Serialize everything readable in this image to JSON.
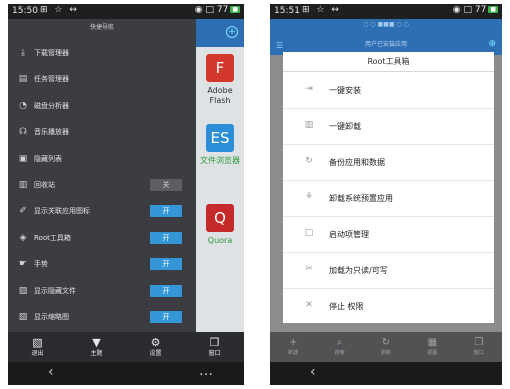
{
  "left_phone": {
    "status": {
      "time": "15:50",
      "icons": "⊞ ☆ ↔",
      "right": "◉ □ 77",
      "battery": "■"
    },
    "drawer_title": "快捷导航",
    "items": [
      {
        "icon": "⤓",
        "icon_name": "download-icon",
        "label": "下载管理器"
      },
      {
        "icon": "▤",
        "icon_name": "task-icon",
        "label": "任务管理器"
      },
      {
        "icon": "◔",
        "icon_name": "disk-icon",
        "label": "磁盘分析器"
      },
      {
        "icon": "☊",
        "icon_name": "headphones-icon",
        "label": "音乐播放器"
      },
      {
        "icon": "▣",
        "icon_name": "hidden-list-icon",
        "label": "隐藏列表"
      },
      {
        "icon": "▥",
        "icon_name": "trash-icon",
        "label": "回收站",
        "toggle": "关",
        "toggle_on": false
      },
      {
        "icon": "✐",
        "icon_name": "assoc-icon",
        "label": "显示关联应用图标",
        "toggle": "开",
        "toggle_on": true
      },
      {
        "icon": "◈",
        "icon_name": "root-tools-icon",
        "label": "Root工具箱",
        "toggle": "开",
        "toggle_on": true
      },
      {
        "icon": "☛",
        "icon_name": "gesture-icon",
        "label": "手势",
        "toggle": "开",
        "toggle_on": true
      },
      {
        "icon": "▧",
        "icon_name": "hidden-files-icon",
        "label": "显示隐藏文件",
        "toggle": "开",
        "toggle_on": true
      },
      {
        "icon": "▨",
        "icon_name": "thumbnail-icon",
        "label": "显示缩略图",
        "toggle": "开",
        "toggle_on": true
      }
    ],
    "bg_apps": [
      {
        "glyph": "F",
        "color": "#d4372c",
        "label": "Adobe Flash",
        "label_color": "#2b3036"
      },
      {
        "glyph": "ES",
        "color": "#2a8fd6",
        "label": "文件浏览器",
        "label_color": "#2e9a3a"
      },
      {
        "glyph": "Q",
        "color": "#c42a2a",
        "label": "Quora",
        "label_color": "#2e9a3a"
      }
    ],
    "tabs": [
      {
        "icon": "▧",
        "label": "退出"
      },
      {
        "icon": "▼",
        "label": "主题"
      },
      {
        "icon": "⚙",
        "label": "设置"
      },
      {
        "icon": "❐",
        "label": "窗口"
      }
    ],
    "nav": {
      "back": "‹",
      "more": "…"
    }
  },
  "right_phone": {
    "status": {
      "time": "15:51",
      "icons": "⊞ ☆ ↔",
      "right": "◉ □ 77",
      "battery": "■"
    },
    "header_dots": "○ ○ ■■■ ○ ○",
    "header_sub": "用户已安装应用",
    "dialog_title": "Root工具箱",
    "options": [
      {
        "icon": "⇥",
        "icon_name": "install-icon",
        "label": "一键安装"
      },
      {
        "icon": "▥",
        "icon_name": "uninstall-icon",
        "label": "一键卸载"
      },
      {
        "icon": "↻",
        "icon_name": "backup-icon",
        "label": "备份应用和数据"
      },
      {
        "icon": "⚘",
        "icon_name": "system-apps-icon",
        "label": "卸载系统预置应用"
      },
      {
        "icon": "□",
        "icon_name": "startup-icon",
        "label": "启动项管理"
      },
      {
        "icon": "✂",
        "icon_name": "mount-icon",
        "label": "加载为只读/可写"
      },
      {
        "icon": "✕",
        "icon_name": "stop-icon",
        "label": "停止 权限"
      }
    ],
    "tabs": [
      {
        "icon": "+",
        "label": "新建"
      },
      {
        "icon": "⌕",
        "label": "搜索"
      },
      {
        "icon": "↻",
        "label": "刷新"
      },
      {
        "icon": "▦",
        "label": "视图"
      },
      {
        "icon": "❐",
        "label": "窗口"
      }
    ],
    "nav": {
      "back": "‹"
    }
  }
}
